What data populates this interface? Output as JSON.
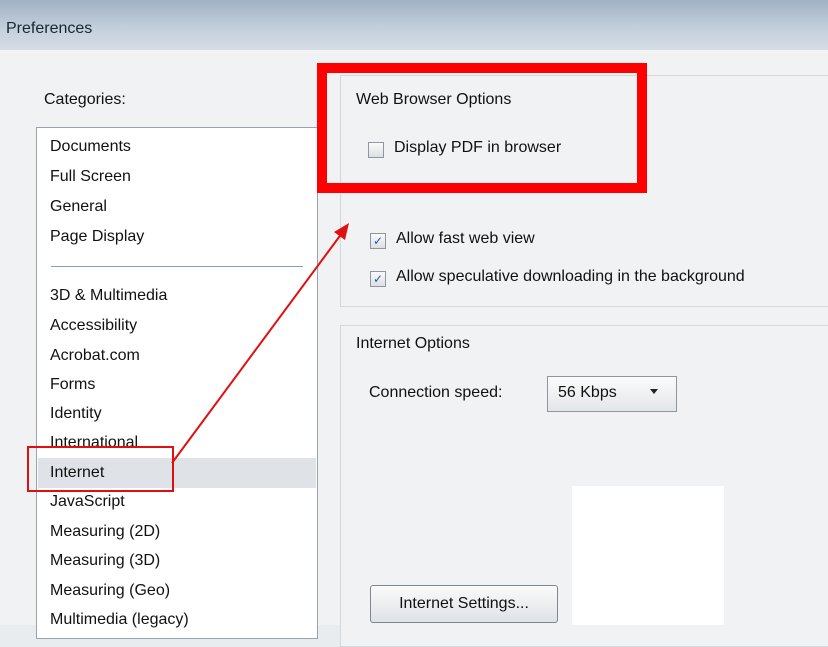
{
  "window": {
    "title": "Preferences"
  },
  "categories": {
    "label": "Categories:",
    "group1": [
      "Documents",
      "Full Screen",
      "General",
      "Page Display"
    ],
    "group2": [
      "3D & Multimedia",
      "Accessibility",
      "Acrobat.com",
      "Forms",
      "Identity",
      "International",
      "Internet",
      "JavaScript",
      "Measuring (2D)",
      "Measuring (3D)",
      "Measuring (Geo)",
      "Multimedia (legacy)"
    ],
    "selected": "Internet"
  },
  "web_browser_options": {
    "title": "Web Browser Options",
    "display_pdf": {
      "label": "Display PDF in browser",
      "checked": false
    },
    "fast_web_view": {
      "label": "Allow fast web view",
      "checked": true
    },
    "speculative_download": {
      "label": "Allow speculative downloading in the background",
      "checked": true
    }
  },
  "internet_options": {
    "title": "Internet Options",
    "connection_speed_label": "Connection speed:",
    "connection_speed_value": "56 Kbps",
    "settings_button": "Internet Settings..."
  },
  "annotation_colors": {
    "highlight": "#ff0000",
    "arrow": "#e01010"
  }
}
